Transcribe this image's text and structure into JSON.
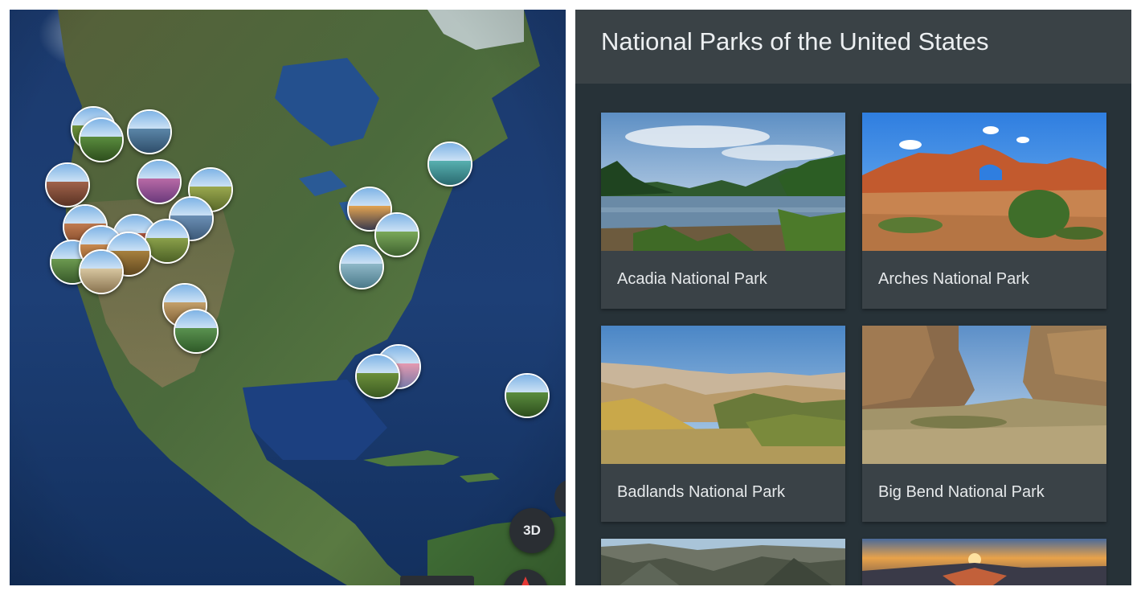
{
  "map": {
    "view_mode_label": "3D",
    "pins": [
      {
        "id": "pin-1",
        "c1": "#6c8f3a",
        "c2": "#3b5a22"
      },
      {
        "id": "pin-2",
        "c1": "#5a8c3e",
        "c2": "#2e4f1d"
      },
      {
        "id": "pin-3",
        "c1": "#5b86a8",
        "c2": "#2f4e6b"
      },
      {
        "id": "pin-4",
        "c1": "#a0624a",
        "c2": "#5a3324"
      },
      {
        "id": "pin-5",
        "c1": "#b86aa6",
        "c2": "#6b3a7c"
      },
      {
        "id": "pin-6",
        "c1": "#9aa84e",
        "c2": "#5a6a2a"
      },
      {
        "id": "pin-7",
        "c1": "#6b8fb4",
        "c2": "#3d5a7a"
      },
      {
        "id": "pin-8",
        "c1": "#c07a4f",
        "c2": "#7a4426"
      },
      {
        "id": "pin-9",
        "c1": "#b35b43",
        "c2": "#6a3022"
      },
      {
        "id": "pin-10",
        "c1": "#8aa04a",
        "c2": "#4d6126"
      },
      {
        "id": "pin-11",
        "c1": "#6c9a50",
        "c2": "#38592a"
      },
      {
        "id": "pin-12",
        "c1": "#c8894f",
        "c2": "#7e4f25"
      },
      {
        "id": "pin-13",
        "c1": "#a7803e",
        "c2": "#604820"
      },
      {
        "id": "pin-14",
        "c1": "#d7c6a0",
        "c2": "#8a7450"
      },
      {
        "id": "pin-15",
        "c1": "#c4a06a",
        "c2": "#7a5c34"
      },
      {
        "id": "pin-16",
        "c1": "#5a9250",
        "c2": "#2f5a28"
      },
      {
        "id": "pin-17",
        "c1": "#e2a350",
        "c2": "#3a3a4e"
      },
      {
        "id": "pin-18",
        "c1": "#7aa85a",
        "c2": "#3f6230"
      },
      {
        "id": "pin-19",
        "c1": "#8fb8c8",
        "c2": "#4b7a8a"
      },
      {
        "id": "pin-20",
        "c1": "#58b0b0",
        "c2": "#2a6a70"
      },
      {
        "id": "pin-21",
        "c1": "#e59ab0",
        "c2": "#7a7aa8"
      }
    ]
  },
  "list": {
    "title": "National Parks of the United States",
    "parks": [
      {
        "name": "Acadia National Park"
      },
      {
        "name": "Arches National Park"
      },
      {
        "name": "Badlands National Park"
      },
      {
        "name": "Big Bend National Park"
      }
    ]
  }
}
